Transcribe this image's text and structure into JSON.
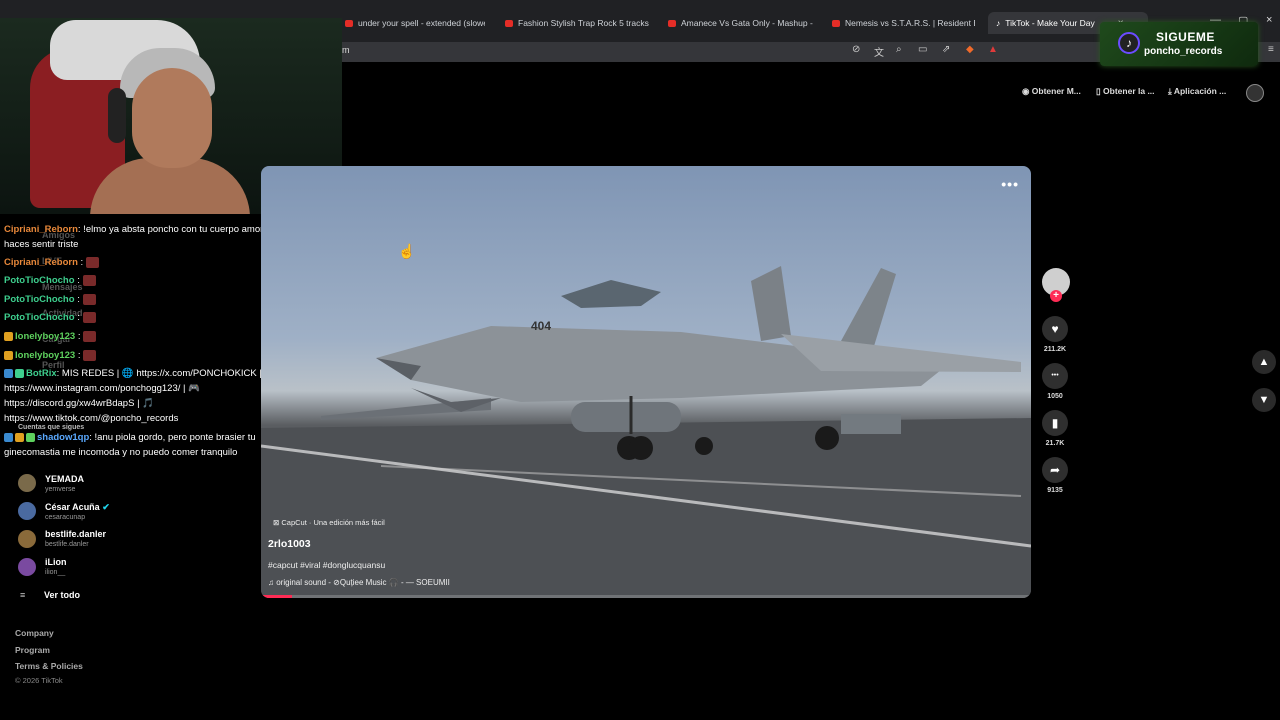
{
  "browser": {
    "tabs": [
      {
        "label": "under your spell - extended (slowed",
        "icon": "youtube-icon"
      },
      {
        "label": "Fashion Stylish Trap Rock 5 tracks by",
        "icon": "youtube-icon"
      },
      {
        "label": "Amanece Vs Gata Only - Mashup - Y",
        "icon": "youtube-icon"
      },
      {
        "label": "Nemesis vs S.T.A.R.S. | Resident Evil 2",
        "icon": "youtube-icon"
      },
      {
        "label": "TikTok - Make Your Day",
        "icon": "tiktok-icon",
        "active": true
      }
    ],
    "url": "m"
  },
  "overlay": {
    "follow_label": "SIGUEME",
    "handle": "poncho_records"
  },
  "header_actions": [
    "Obtener M...",
    "Obtener la ...",
    "Aplicación ..."
  ],
  "sidebar": {
    "nav": [
      "Amigos",
      "LIVE",
      "Mensajes",
      "Actividad",
      "Cargar",
      "Perfil"
    ],
    "following_heading": "Cuentas que sigues",
    "accounts": [
      {
        "name": "YEMADA",
        "handle": "yemverse",
        "verified": false
      },
      {
        "name": "César Acuña",
        "handle": "cesaracunap",
        "verified": true
      },
      {
        "name": "bestlife.danler",
        "handle": "bestlife.danler",
        "verified": false
      },
      {
        "name": "iLion",
        "handle": "ilion__",
        "verified": false
      }
    ],
    "see_all": "Ver todo"
  },
  "footer": {
    "links": [
      "Company",
      "Program",
      "Terms & Policies"
    ],
    "copyright": "© 2026 TikTok"
  },
  "chat": [
    {
      "user": "Cipriani_Reborn",
      "color": "#e8883a",
      "text": ": !elmo ya absta poncho con tu cuerpo amorfo me"
    },
    {
      "user": "",
      "color": "#fff",
      "text": "haces sentir triste"
    },
    {
      "user": "Cipriani_Reborn",
      "color": "#e8883a",
      "text": ":",
      "emote": true
    },
    {
      "user": "PotoTioChocho",
      "color": "#3ecf8e",
      "text": ":",
      "emote": true
    },
    {
      "user": "PotoTioChocho",
      "color": "#3ecf8e",
      "text": ":",
      "emote": true
    },
    {
      "user": "PotoTioChocho",
      "color": "#3ecf8e",
      "text": ":",
      "emote": true
    },
    {
      "user": "lonelyboy123",
      "color": "#5ed15e",
      "text": ":",
      "emote": true
    },
    {
      "user": "lonelyboy123",
      "color": "#5ed15e",
      "text": ":",
      "emote": true
    },
    {
      "user": "BotRix",
      "color": "#3ecf8e",
      "text": ": MIS REDES | 🌐 https://x.com/PONCHOKICK | 📷"
    },
    {
      "user": "",
      "color": "#fff",
      "text": "https://www.instagram.com/ponchogg123/ | 🎮"
    },
    {
      "user": "",
      "color": "#fff",
      "text": "https://discord.gg/xw4wrBdapS | 🎵"
    },
    {
      "user": "",
      "color": "#fff",
      "text": "https://www.tiktok.com/@poncho_records"
    },
    {
      "user": "shadow1qp",
      "color": "#5aa9ff",
      "text": ": !anu piola gordo, pero ponte brasier tu"
    },
    {
      "user": "",
      "color": "#fff",
      "text": "ginecomastia me incomoda y no puedo comer tranquilo"
    }
  ],
  "video": {
    "capcut_label": "CapCut · Una edición más fácil",
    "author": "2rlo1003",
    "tags": "#capcut #viral #donglucquansu",
    "sound": "original sound - ⊘Quțiee Music 🎧 - — SOEUMII",
    "progress": 0.04,
    "jet_number": "404"
  },
  "actions": [
    {
      "name": "like",
      "icon": "heart-icon",
      "glyph": "♥",
      "count": "211.2K"
    },
    {
      "name": "comment",
      "icon": "comment-icon",
      "glyph": "•••",
      "count": "1050"
    },
    {
      "name": "save",
      "icon": "bookmark-icon",
      "glyph": "▮",
      "count": "21.7K"
    },
    {
      "name": "share",
      "icon": "share-icon",
      "glyph": "➦",
      "count": "9135"
    }
  ]
}
